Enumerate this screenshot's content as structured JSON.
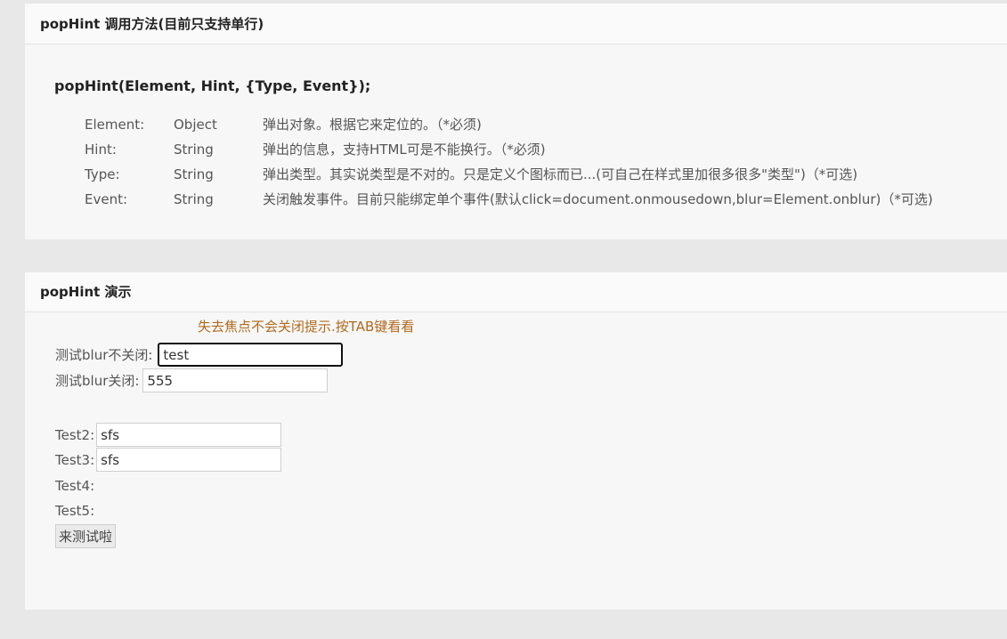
{
  "usage": {
    "header": "popHint 调用方法(目前只支持单行)",
    "signature": "popHint(Element, Hint, {Type, Event});",
    "params": [
      {
        "name": "Element:",
        "type": "Object",
        "desc": "弹出对象。根据它来定位的。（*必须)"
      },
      {
        "name": "Hint:",
        "type": "String",
        "desc": "弹出的信息，支持HTML可是不能换行。（*必须)"
      },
      {
        "name": "Type:",
        "type": "String",
        "desc": "弹出类型。其实说类型是不对的。只是定义个图标而已...(可自己在样式里加很多很多\"类型\")（*可选)"
      },
      {
        "name": "Event:",
        "type": "String",
        "desc": "关闭触发事件。目前只能绑定单个事件(默认click=document.onmousedown,blur=Element.onblur)（*可选)"
      }
    ]
  },
  "demo": {
    "header": "popHint 演示",
    "hint_text": "失去焦点不会关闭提示.按TAB键看看",
    "blur_no_close": {
      "label": "测试blur不关闭:",
      "value": "test"
    },
    "blur_close": {
      "label": "测试blur关闭:",
      "value": "555"
    },
    "test2": {
      "label": "Test2:",
      "value": "sfs"
    },
    "test3": {
      "label": "Test3:",
      "value": "sfs"
    },
    "test4": {
      "label": "Test4:"
    },
    "test5": {
      "label": "Test5:"
    },
    "button_label": "来测试啦"
  }
}
